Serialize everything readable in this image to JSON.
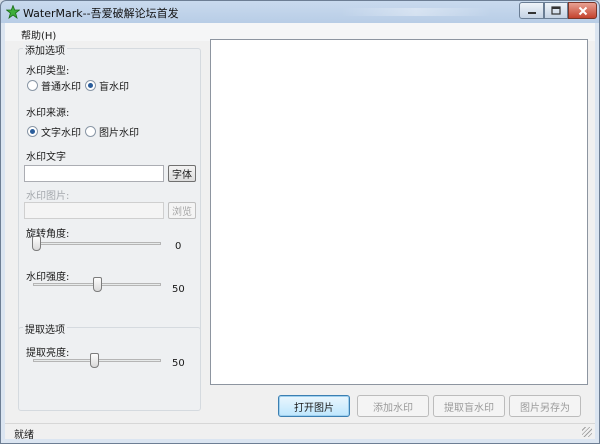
{
  "window": {
    "title": "WaterMark--吾爱破解论坛首发"
  },
  "menu": {
    "help": "帮助(H)"
  },
  "add_group": {
    "title": "添加选项",
    "type_label": "水印类型:",
    "type_options": [
      {
        "label": "普通水印",
        "selected": false
      },
      {
        "label": "盲水印",
        "selected": true
      }
    ],
    "source_label": "水印来源:",
    "source_options": [
      {
        "label": "文字水印",
        "selected": true
      },
      {
        "label": "图片水印",
        "selected": false
      }
    ],
    "text_label": "水印文字",
    "text_value": "",
    "font_button": "字体",
    "image_label": "水印图片:",
    "image_value": "",
    "browse_button": "浏览",
    "rotation_label": "旋转角度:",
    "rotation_value": "0",
    "strength_label": "水印强度:",
    "strength_value": "50"
  },
  "extract_group": {
    "title": "提取选项",
    "brightness_label": "提取亮度:",
    "brightness_value": "50"
  },
  "actions": {
    "open": "打开图片",
    "add": "添加水印",
    "extract": "提取盲水印",
    "save_as": "图片另存为"
  },
  "status": {
    "text": "就绪"
  },
  "colors": {
    "accent": "#2a5d9b",
    "title_bar": "#b8cde6",
    "close": "#c4432e"
  }
}
